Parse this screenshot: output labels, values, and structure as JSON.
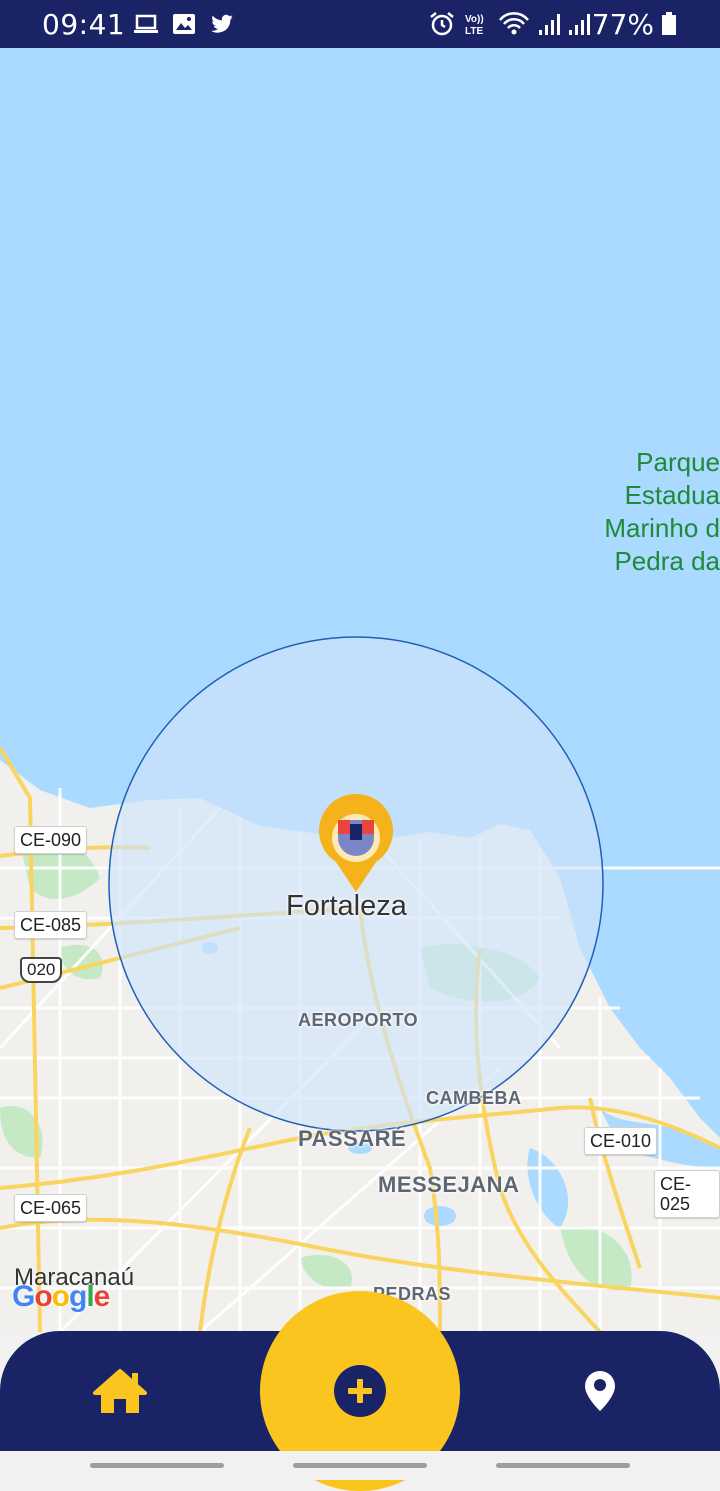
{
  "status_bar": {
    "time": "09:41",
    "battery_percent": "77%",
    "left_icons": [
      "laptop-icon",
      "image-icon",
      "twitter-icon"
    ],
    "right_icons": [
      "alarm-icon",
      "volte-icon",
      "wifi-icon",
      "signal-icon",
      "signal-icon",
      "battery-icon"
    ],
    "volte_text": "Vo)) LTE"
  },
  "map": {
    "park_label_lines": [
      "Parque",
      "Estadua",
      "Marinho d",
      "Pedra da"
    ],
    "city_name": "Fortaleza",
    "districts": [
      "AEROPORTO",
      "CAMBEBA",
      "PASSARÉ",
      "MESSEJANA",
      "PEDRAS",
      "Maracanaú"
    ],
    "road_shields": [
      "CE-090",
      "CE-085",
      "020",
      "CE-065",
      "CE-010",
      "CE-025"
    ],
    "attribution": "Google",
    "colors": {
      "water": "#aadaff",
      "land": "#f1f0ed",
      "radius_fill": "#cfe3fb",
      "radius_stroke": "#1f5fb8",
      "highway": "#f9d560",
      "park": "#c5e8c5"
    }
  },
  "bottom_nav": {
    "home_icon": "home-icon",
    "add_icon": "plus-circle-icon",
    "location_icon": "location-pin-icon",
    "colors": {
      "bar": "#1a2366",
      "accent": "#fbc520"
    }
  }
}
